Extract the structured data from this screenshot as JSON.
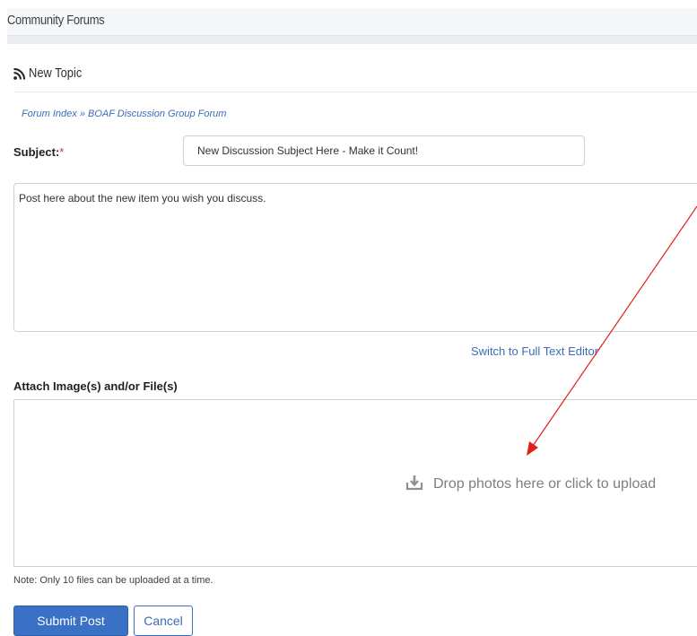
{
  "header": {
    "title": "Community Forums"
  },
  "section": {
    "title": "New Topic",
    "icon": "rss-icon"
  },
  "breadcrumb": {
    "index_label": "Forum Index",
    "separator": "»",
    "forum_label": "BOAF Discussion Group Forum"
  },
  "form": {
    "subject_label": "Subject:",
    "required_mark": "*",
    "subject_value": "New Discussion Subject Here - Make it Count!",
    "body_value": "Post here about the new item you wish you discuss.",
    "switch_editor_label": "Switch to Full Text Editor",
    "attach_label": "Attach Image(s) and/or File(s)",
    "dropzone_text": "Drop photos here or click to upload",
    "dropzone_icon": "upload-icon",
    "note": "Note: Only 10 files can be uploaded at a time.",
    "submit_label": "Submit Post",
    "cancel_label": "Cancel"
  },
  "colors": {
    "link": "#3b6cb8",
    "primary_button": "#3a70c6",
    "required": "#d0342c",
    "annotation": "#e0201a"
  }
}
